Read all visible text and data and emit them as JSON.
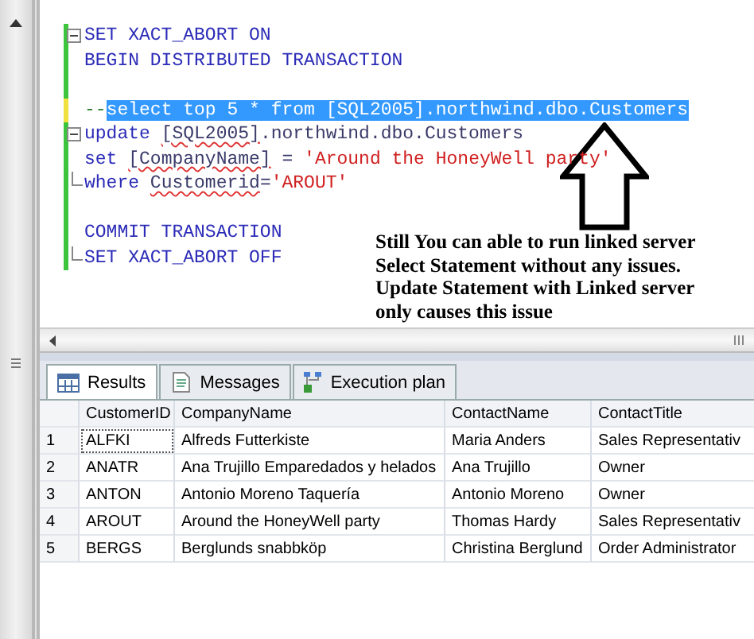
{
  "editor": {
    "lines": [
      {
        "collapsible": true,
        "block_end": false,
        "modified": false,
        "tokens": [
          {
            "kind": "keyword",
            "text": "SET XACT_ABORT ON",
            "selected": false,
            "misspelled": false
          }
        ]
      },
      {
        "collapsible": false,
        "block_end": false,
        "modified": false,
        "tokens": [
          {
            "kind": "keyword",
            "text": "BEGIN DISTRIBUTED TRANSACTION",
            "selected": false,
            "misspelled": false
          }
        ]
      },
      {
        "collapsible": false,
        "block_end": false,
        "modified": false
      },
      {
        "collapsible": false,
        "block_end": false,
        "modified": true,
        "tokens": [
          {
            "kind": "comment",
            "text": "--",
            "selected": false,
            "misspelled": false
          },
          {
            "kind": "comment",
            "text": "select top 5 * from [SQL2005].northwind.dbo.Customers",
            "selected": true,
            "misspelled": false
          }
        ]
      },
      {
        "collapsible": true,
        "block_end": false,
        "modified": false,
        "tokens": [
          {
            "kind": "keyword",
            "text": "update ",
            "selected": false,
            "misspelled": false
          },
          {
            "kind": "plain",
            "text": "[SQL2005]",
            "selected": false,
            "misspelled": true
          },
          {
            "kind": "plain",
            "text": ".northwind.dbo.Customers",
            "selected": false,
            "misspelled": false
          }
        ]
      },
      {
        "collapsible": false,
        "block_end": false,
        "modified": false,
        "tokens": [
          {
            "kind": "keyword",
            "text": "set ",
            "selected": false,
            "misspelled": false
          },
          {
            "kind": "plain",
            "text": "[CompanyName]",
            "selected": false,
            "misspelled": true
          },
          {
            "kind": "plain",
            "text": " = ",
            "selected": false,
            "misspelled": false
          },
          {
            "kind": "string",
            "text": "'Around the HoneyWell party'",
            "selected": false,
            "misspelled": false
          }
        ]
      },
      {
        "collapsible": false,
        "block_end": true,
        "modified": false,
        "tokens": [
          {
            "kind": "keyword",
            "text": "where ",
            "selected": false,
            "misspelled": false
          },
          {
            "kind": "plain",
            "text": "Customerid",
            "selected": false,
            "misspelled": true
          },
          {
            "kind": "plain",
            "text": "=",
            "selected": false,
            "misspelled": false
          },
          {
            "kind": "string",
            "text": "'AROUT'",
            "selected": false,
            "misspelled": false
          }
        ]
      },
      {
        "collapsible": false,
        "block_end": false,
        "modified": false
      },
      {
        "collapsible": false,
        "block_end": false,
        "modified": false,
        "tokens": [
          {
            "kind": "keyword",
            "text": "COMMIT TRANSACTION",
            "selected": false,
            "misspelled": false
          }
        ]
      },
      {
        "collapsible": false,
        "block_end": true,
        "modified": false,
        "tokens": [
          {
            "kind": "keyword",
            "text": "SET XACT_ABORT OFF",
            "selected": false,
            "misspelled": false
          }
        ]
      }
    ]
  },
  "annotation": {
    "lines": [
      "Still You can able to run linked server",
      "Select Statement without any issues.",
      "Update Statement with Linked server",
      "only causes this issue"
    ]
  },
  "results_tabs": [
    {
      "label": "Results",
      "kind": "grid",
      "selected": true
    },
    {
      "label": "Messages",
      "kind": "messages",
      "selected": false
    },
    {
      "label": "Execution plan",
      "kind": "plan",
      "selected": false
    }
  ],
  "grid": {
    "columns": [
      "CustomerID",
      "CompanyName",
      "ContactName",
      "ContactTitle"
    ],
    "rows": [
      {
        "number": "1",
        "cells": [
          {
            "text": "ALFKI",
            "focused": true
          },
          {
            "text": "Alfreds Futterkiste",
            "focused": false
          },
          {
            "text": "Maria Anders",
            "focused": false
          },
          {
            "text": "Sales Representativ",
            "focused": false
          }
        ]
      },
      {
        "number": "2",
        "cells": [
          {
            "text": "ANATR",
            "focused": false
          },
          {
            "text": "Ana Trujillo Emparedados y helados",
            "focused": false
          },
          {
            "text": "Ana Trujillo",
            "focused": false
          },
          {
            "text": "Owner",
            "focused": false
          }
        ]
      },
      {
        "number": "3",
        "cells": [
          {
            "text": "ANTON",
            "focused": false
          },
          {
            "text": "Antonio Moreno Taquería",
            "focused": false
          },
          {
            "text": "Antonio Moreno",
            "focused": false
          },
          {
            "text": "Owner",
            "focused": false
          }
        ]
      },
      {
        "number": "4",
        "cells": [
          {
            "text": "AROUT",
            "focused": false
          },
          {
            "text": "Around the HoneyWell party",
            "focused": false
          },
          {
            "text": "Thomas Hardy",
            "focused": false
          },
          {
            "text": "Sales Representativ",
            "focused": false
          }
        ]
      },
      {
        "number": "5",
        "cells": [
          {
            "text": "BERGS",
            "focused": false
          },
          {
            "text": "Berglunds snabbköp",
            "focused": false
          },
          {
            "text": "Christina Berglund",
            "focused": false
          },
          {
            "text": "Order Administrator",
            "focused": false
          }
        ]
      }
    ]
  }
}
